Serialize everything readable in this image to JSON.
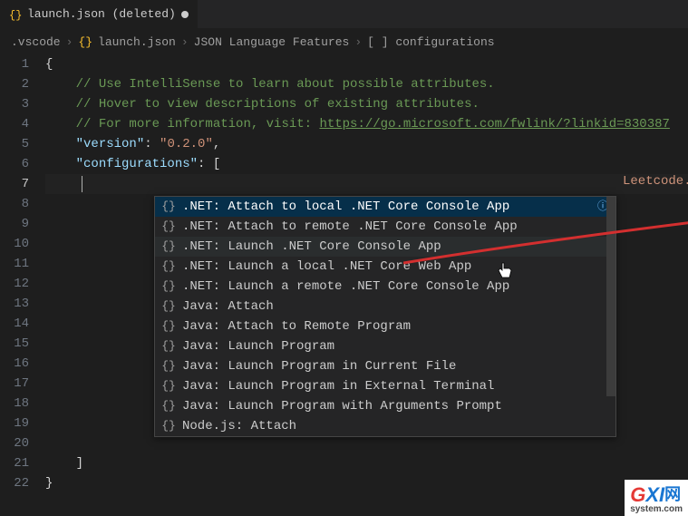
{
  "tab": {
    "filename": "launch.json (deleted)",
    "icon_name": "json-icon"
  },
  "breadcrumb": {
    "parts": [
      ".vscode",
      "launch.json",
      "JSON Language Features",
      "[ ] configurations"
    ]
  },
  "code": {
    "lines": [
      {
        "n": 1,
        "text_parts": [
          {
            "t": "{",
            "c": "brace"
          }
        ]
      },
      {
        "n": 2,
        "text_parts": [
          {
            "t": "    ",
            "c": "ind"
          },
          {
            "t": "// Use IntelliSense to learn about possible attributes.",
            "c": "comment"
          }
        ]
      },
      {
        "n": 3,
        "text_parts": [
          {
            "t": "    ",
            "c": "ind"
          },
          {
            "t": "// Hover to view descriptions of existing attributes.",
            "c": "comment"
          }
        ]
      },
      {
        "n": 4,
        "text_parts": [
          {
            "t": "    ",
            "c": "ind"
          },
          {
            "t": "// For more information, visit: ",
            "c": "comment"
          },
          {
            "t": "https://go.microsoft.com/fwlink/?linkid=830387",
            "c": "link"
          }
        ]
      },
      {
        "n": 5,
        "text_parts": [
          {
            "t": "    ",
            "c": "ind"
          },
          {
            "t": "\"version\"",
            "c": "prop"
          },
          {
            "t": ": ",
            "c": "punc"
          },
          {
            "t": "\"0.2.0\"",
            "c": "str"
          },
          {
            "t": ",",
            "c": "punc"
          }
        ]
      },
      {
        "n": 6,
        "text_parts": [
          {
            "t": "    ",
            "c": "ind"
          },
          {
            "t": "\"configurations\"",
            "c": "prop"
          },
          {
            "t": ": [",
            "c": "punc"
          }
        ]
      },
      {
        "n": 7,
        "active": true,
        "cursor": true,
        "text_parts": []
      },
      {
        "n": 8,
        "text_parts": []
      },
      {
        "n": 9,
        "text_parts": []
      },
      {
        "n": 10,
        "text_parts": []
      },
      {
        "n": 11,
        "text_parts": []
      },
      {
        "n": 12,
        "text_parts": []
      },
      {
        "n": 13,
        "text_parts": []
      },
      {
        "n": 14,
        "text_parts": []
      },
      {
        "n": 15,
        "text_parts": []
      },
      {
        "n": 16,
        "text_parts": []
      },
      {
        "n": 17,
        "text_parts": []
      },
      {
        "n": 18,
        "text_parts": []
      },
      {
        "n": 19,
        "text_parts": []
      },
      {
        "n": 20,
        "text_parts": []
      },
      {
        "n": 21,
        "text_parts": [
          {
            "t": "    ",
            "c": "ind"
          },
          {
            "t": "]",
            "c": "punc"
          }
        ]
      },
      {
        "n": 22,
        "text_parts": [
          {
            "t": "}",
            "c": "brace"
          }
        ]
      }
    ]
  },
  "background_partial_text": "Leetcode.dll\",",
  "suggestions": {
    "items": [
      {
        "label": ".NET: Attach to local .NET Core Console App",
        "selected": true
      },
      {
        "label": ".NET: Attach to remote .NET Core Console App"
      },
      {
        "label": ".NET: Launch .NET Core Console App",
        "hovered": true
      },
      {
        "label": ".NET: Launch a local .NET Core Web App"
      },
      {
        "label": ".NET: Launch a remote .NET Core Console App"
      },
      {
        "label": "Java: Attach"
      },
      {
        "label": "Java: Attach to Remote Program"
      },
      {
        "label": "Java: Launch Program"
      },
      {
        "label": "Java: Launch Program in Current File"
      },
      {
        "label": "Java: Launch Program in External Terminal"
      },
      {
        "label": "Java: Launch Program with Arguments Prompt"
      },
      {
        "label": "Node.js: Attach"
      }
    ],
    "info_icon": "ⓘ"
  },
  "watermark": {
    "text1": "G",
    "text2": "XI",
    "text3": "网",
    "site": "system.com"
  }
}
